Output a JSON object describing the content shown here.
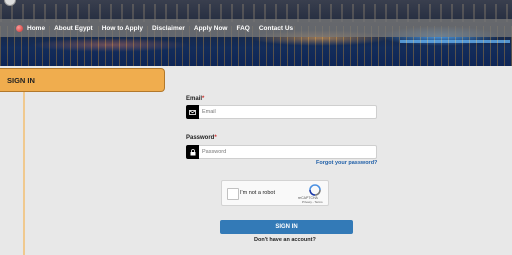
{
  "nav": {
    "items": [
      "Home",
      "About Egypt",
      "How to Apply",
      "Disclaimer",
      "Apply Now",
      "FAQ",
      "Contact Us"
    ]
  },
  "signin_tab": {
    "label": "SIGN IN"
  },
  "form": {
    "email": {
      "label": "Email",
      "required_mark": "*",
      "placeholder": "Email",
      "value": ""
    },
    "password": {
      "label": "Password",
      "required_mark": "*",
      "placeholder": "Password",
      "value": ""
    },
    "forgot_link": "Forgot your password?",
    "captcha": {
      "label": "I'm not a robot",
      "brand": "reCAPTCHA",
      "terms": "Privacy - Terms"
    },
    "submit_label": "SIGN IN",
    "no_account_text": "Don't have an account?"
  },
  "colors": {
    "tab": "#f0ad4e",
    "button": "#337ab7",
    "link": "#1f5fa8"
  }
}
